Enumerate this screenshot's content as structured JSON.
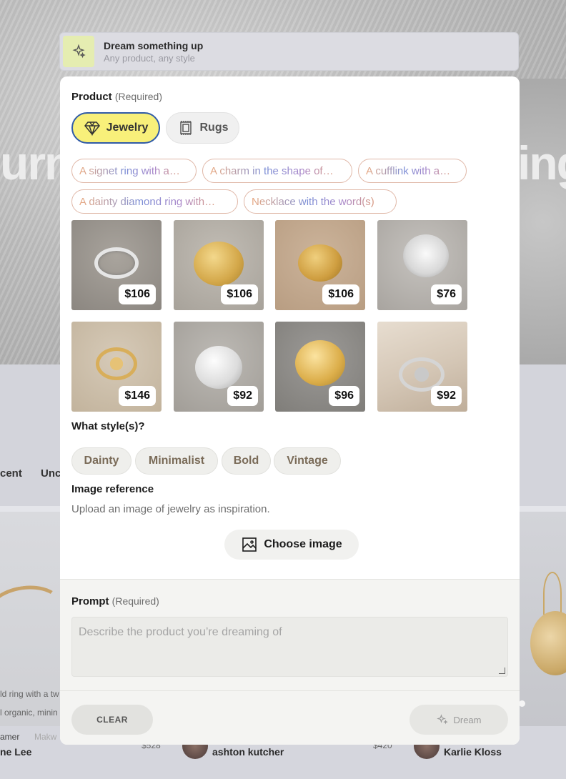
{
  "background": {
    "hero_left": "urn",
    "hero_right": "ing",
    "tabs": [
      "cent",
      "Unc"
    ],
    "card_left": {
      "line1": "ld ring with a tw",
      "line2": "l organic, minin",
      "maker": "amer",
      "maker2": "Makw",
      "name": "ne Lee"
    },
    "card_mid": {
      "price": "$528",
      "name": "ashton kutcher"
    },
    "card_right": {
      "price": "$420",
      "name": "Karlie Kloss"
    }
  },
  "top_bar": {
    "title": "Dream something up",
    "subtitle": "Any product, any style",
    "icon": "sparkle-icon"
  },
  "product": {
    "label": "Product",
    "required": "(Required)",
    "options": [
      {
        "label": "Jewelry",
        "icon": "diamond-icon",
        "selected": true
      },
      {
        "label": "Rugs",
        "icon": "rug-icon",
        "selected": false
      }
    ]
  },
  "suggestions": [
    "A signet ring with a…",
    "A charm in the shape of…",
    "A cufflink with a…",
    "A dainty diamond ring with…",
    "Necklace with the word(s)"
  ],
  "gallery": [
    {
      "price": "$106",
      "tone": "silver"
    },
    {
      "price": "$106",
      "tone": "gold"
    },
    {
      "price": "$106",
      "tone": "gold"
    },
    {
      "price": "$76",
      "tone": "silver"
    },
    {
      "price": "$146",
      "tone": "gold"
    },
    {
      "price": "$92",
      "tone": "silver"
    },
    {
      "price": "$96",
      "tone": "gold"
    },
    {
      "price": "$92",
      "tone": "silver"
    }
  ],
  "style": {
    "label": "What style(s)?",
    "options": [
      "Dainty",
      "Minimalist",
      "Bold",
      "Vintage"
    ]
  },
  "image_reference": {
    "label": "Image reference",
    "hint": "Upload an image of jewelry as inspiration.",
    "button": "Choose image"
  },
  "prompt": {
    "label": "Prompt",
    "required": "(Required)",
    "placeholder": "Describe the product you’re dreaming of"
  },
  "footer": {
    "clear": "CLEAR",
    "dream": "Dream"
  },
  "colors": {
    "selected_fill": "#f8f07a",
    "selected_border": "#2f5aa7",
    "top_icon_bg": "#e5edb1"
  }
}
